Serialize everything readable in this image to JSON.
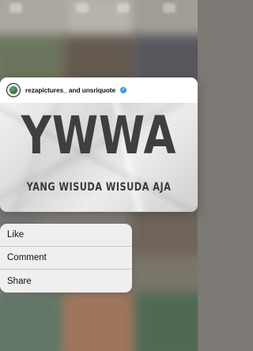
{
  "preview": {
    "username": "rezapictures_ and unsriquote",
    "headline": "YWWA",
    "subheadline": "YANG WISUDA WISUDA AJA"
  },
  "menu": {
    "items": [
      {
        "label": "Like"
      },
      {
        "label": "Comment"
      },
      {
        "label": "Share"
      }
    ]
  },
  "colors": {
    "verified": "#3897f0",
    "headline": "#3f3f3f"
  },
  "icons": {
    "verified": "verified-badge-icon"
  }
}
